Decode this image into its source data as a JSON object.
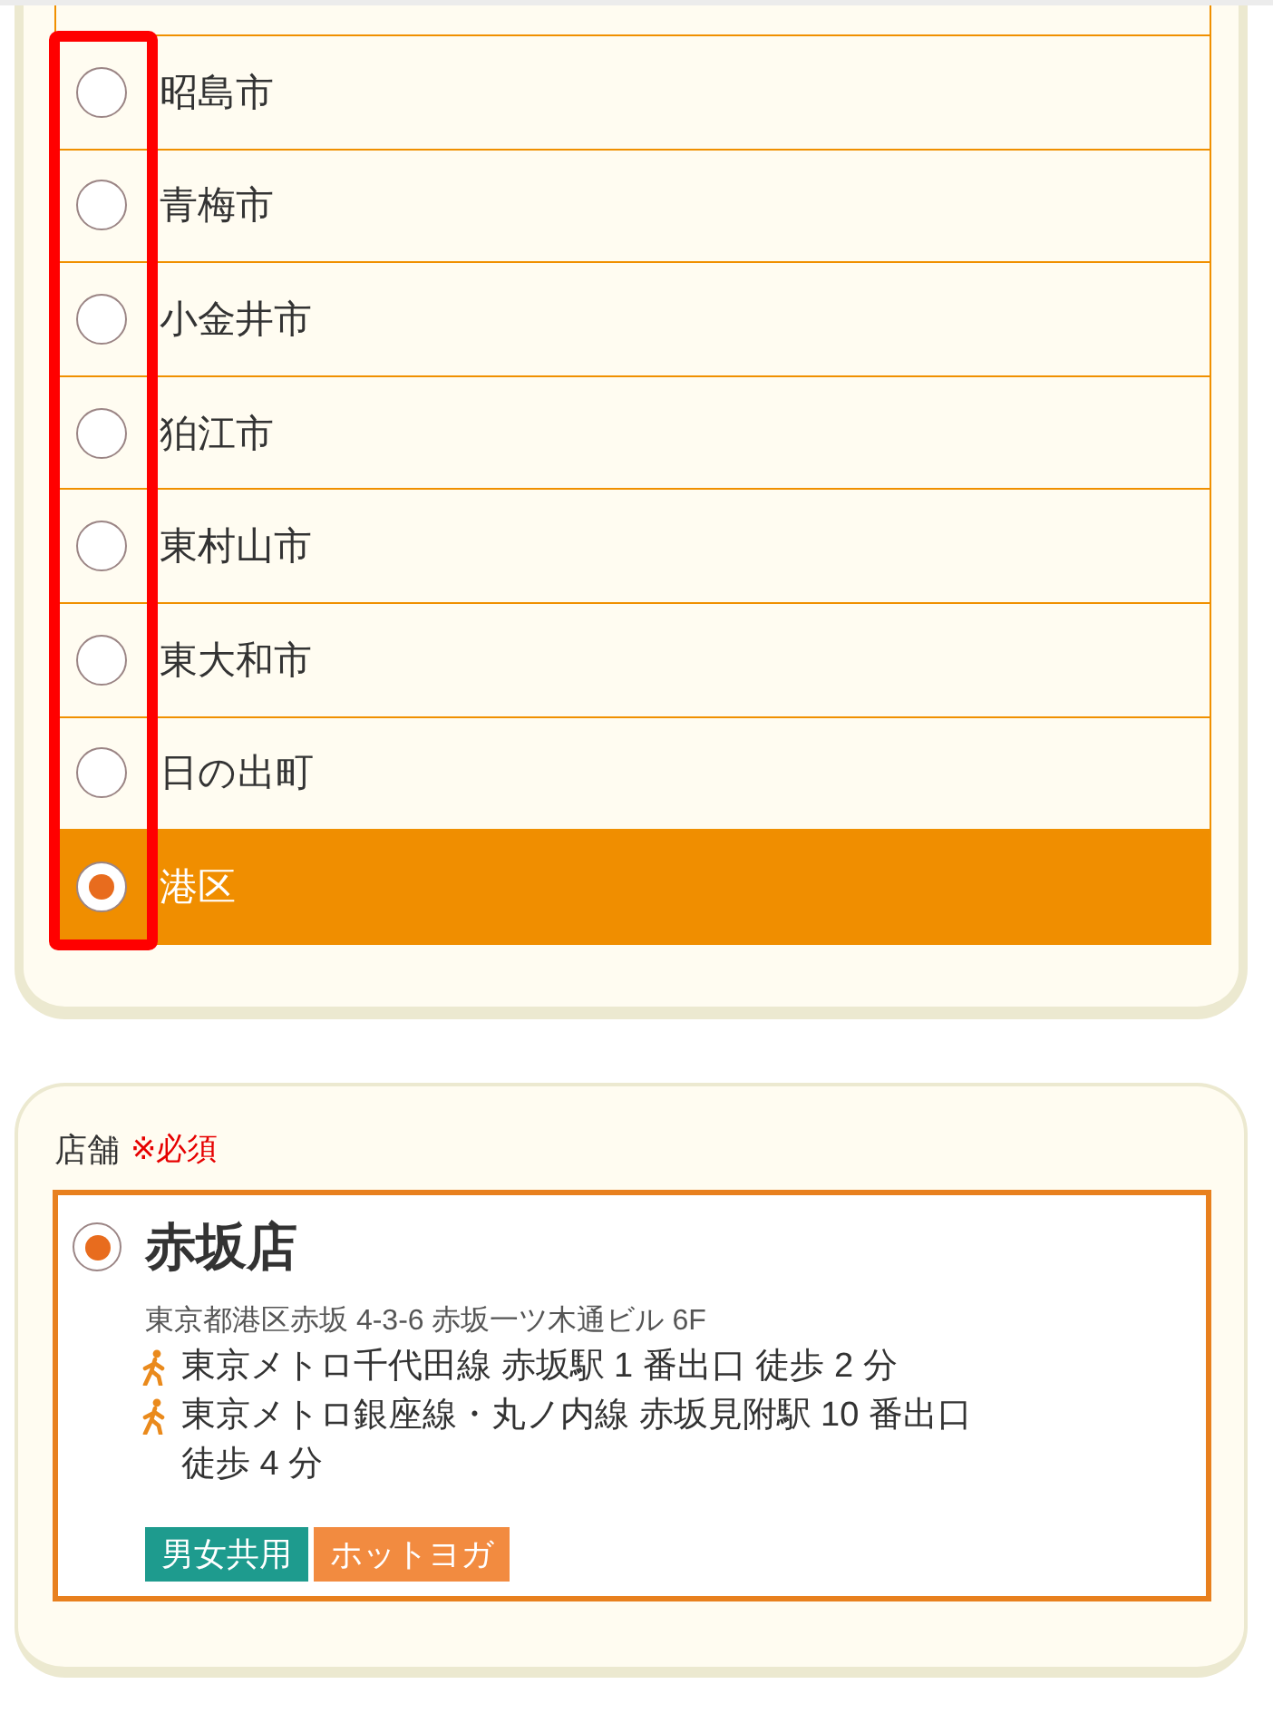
{
  "area_list": {
    "items": [
      {
        "label": "昭島市",
        "selected": false
      },
      {
        "label": "青梅市",
        "selected": false
      },
      {
        "label": "小金井市",
        "selected": false
      },
      {
        "label": "狛江市",
        "selected": false
      },
      {
        "label": "東村山市",
        "selected": false
      },
      {
        "label": "東大和市",
        "selected": false
      },
      {
        "label": "日の出町",
        "selected": false
      },
      {
        "label": "港区",
        "selected": true
      }
    ]
  },
  "store_section": {
    "label": "店舗",
    "required_note": "※必須",
    "stores": [
      {
        "name": "赤坂店",
        "selected": true,
        "address": "東京都港区赤坂 4-3-6 赤坂一ツ木通ビル 6F",
        "access": [
          {
            "route": "東京メトロ千代田線 赤坂駅 1 番出口",
            "walk": "徒歩 2 分"
          },
          {
            "route": "東京メトロ銀座線・丸ノ内線 赤坂見附駅 10 番出口",
            "walk": "徒歩 4 分"
          }
        ],
        "tags": [
          {
            "label": "男女共用",
            "color": "#1e9b8e"
          },
          {
            "label": "ホットヨガ",
            "color": "#f28b40"
          }
        ]
      }
    ]
  }
}
